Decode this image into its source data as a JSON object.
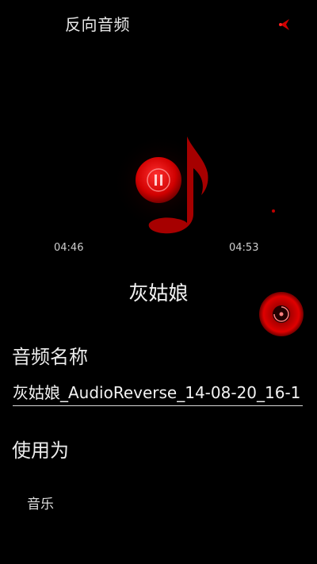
{
  "header": {
    "title": "反向音频",
    "share_icon": "share-icon"
  },
  "player": {
    "current_time": "04:46",
    "total_time": "04:53",
    "song_title": "灰姑娘",
    "play_icon": "pause-icon",
    "record_icon": "record-icon",
    "accent_color": "#e00000"
  },
  "form": {
    "name_label": "音频名称",
    "name_value": "灰姑娘_AudioReverse_14-08-20_16-1",
    "use_as_label": "使用为",
    "use_as_option": "音乐"
  }
}
